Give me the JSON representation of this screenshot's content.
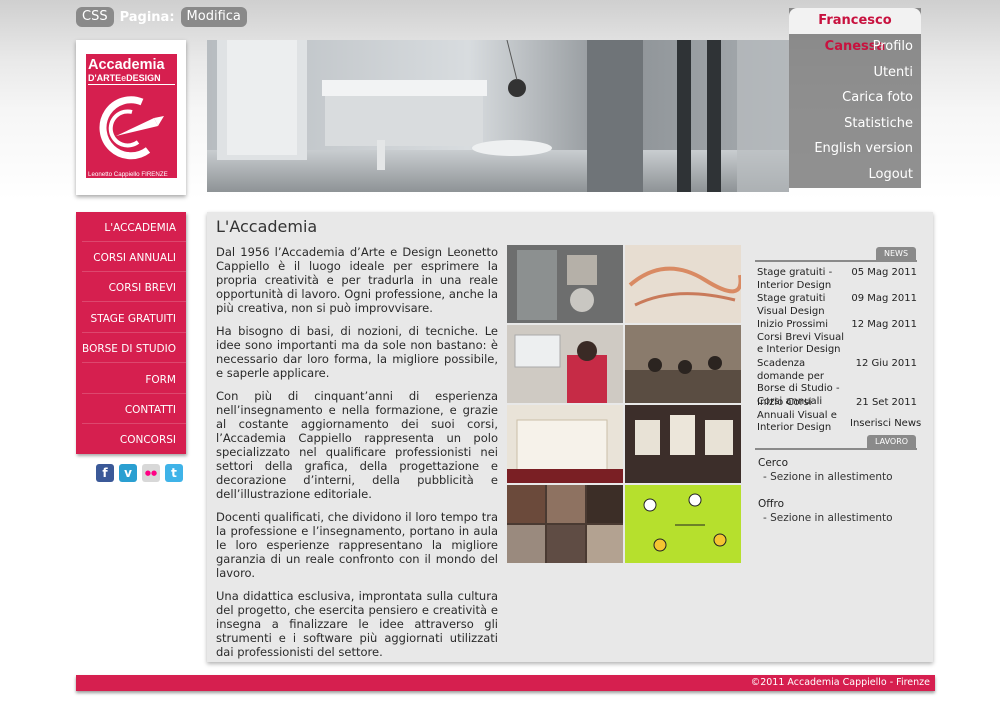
{
  "admin_bar": {
    "css_label": "CSS",
    "page_label": "Pagina:",
    "edit_label": "Modifica"
  },
  "user_menu": {
    "name": "Francesco Canessa",
    "items": [
      "Profilo",
      "Utenti",
      "Carica foto",
      "Statistiche",
      "English version",
      "Logout"
    ]
  },
  "logo": {
    "line1": "Accademia",
    "line2": "D'ARTE e DESIGN",
    "line3": "Leonetto Cappiello FIRENZE"
  },
  "nav": {
    "items": [
      "L'ACCADEMIA",
      "CORSI ANNUALI",
      "CORSI BREVI",
      "STAGE GRATUITI",
      "BORSE DI STUDIO",
      "FORM",
      "CONTATTI",
      "CONCORSI"
    ]
  },
  "social": {
    "facebook": "f",
    "vimeo": "v",
    "flickr": "●●",
    "twitter": "t"
  },
  "main": {
    "title": "L'Accademia",
    "paragraphs": [
      "Dal 1956 l’Accademia d’Arte e Design Leonetto Cappiello è il luogo ideale per esprimere la propria creatività e per tradurla in una reale opportunità di lavoro. Ogni professione, anche la più creativa, non si può improvvisare.",
      "Ha bisogno di basi, di nozioni, di tecniche. Le idee sono importanti ma da sole non bastano: è necessario dar loro forma, la migliore possibile, e saperle applicare.",
      "Con più di cinquant’anni di esperienza nell’insegnamento e nella formazione, e grazie al costante aggiornamento dei suoi corsi, l’Accademia Cappiello rappresenta un polo specializzato nel qualificare professionisti nei settori della grafica, della progettazione e decorazione d’interni, della pubblicità e dell’illustrazione editoriale.",
      "Docenti qualificati, che dividono il loro tempo tra la professione e l’insegnamento, portano in aula le loro esperienze rappresentano la migliore garanzia di un reale confronto con il mondo del lavoro.",
      "Una didattica esclusiva, improntata sulla cultura del progetto, che esercita pensiero e creatività e insegna a finalizzare le idee attraverso gli strumenti e i software più aggiornati utilizzati dai professionisti del settore."
    ]
  },
  "news": {
    "header": "NEWS",
    "items": [
      {
        "title": "Stage gratuiti - Interior Design",
        "date": "05 Mag 2011"
      },
      {
        "title": "Stage gratuiti Visual Design",
        "date": "09 Mag 2011"
      },
      {
        "title": "Inizio Prossimi Corsi Brevi Visual e Interior Design",
        "date": "12 Mag 2011"
      },
      {
        "title": "Scadenza domande per Borse di Studio - Corsi annuali",
        "date": "12 Giu 2011"
      },
      {
        "title": "Inizio Corsi Annuali Visual e Interior Design",
        "date": "21 Set 2011"
      }
    ],
    "insert_label": "Inserisci News"
  },
  "lavoro": {
    "header": "LAVORO",
    "cerco": "Cerco",
    "cerco_sub": "- Sezione in allestimento",
    "offro": "Offro",
    "offro_sub": "- Sezione in allestimento"
  },
  "footer": {
    "text": "©2011 Accademia Cappiello - Firenze"
  },
  "colors": {
    "accent": "#d61f4f",
    "gray": "#8a8a8a",
    "panel": "#e8e8e8"
  }
}
